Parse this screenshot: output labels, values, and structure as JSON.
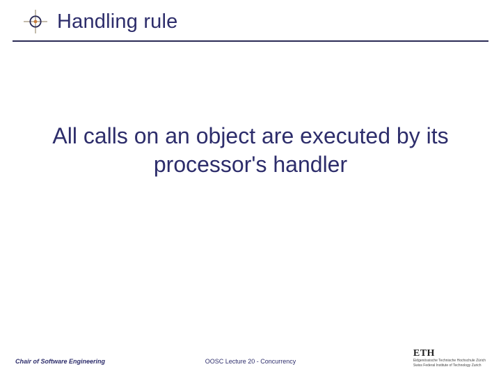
{
  "header": {
    "title": "Handling rule",
    "icon": "cross-dot-icon"
  },
  "body": {
    "text": "All calls on an object are executed by its processor's handler"
  },
  "footer": {
    "left": "Chair of Software Engineering",
    "center": "OOSC  Lecture 20 - Concurrency",
    "logo": "ETH",
    "logo_sub1": "Eidgenössische Technische Hochschule Zürich",
    "logo_sub2": "Swiss Federal Institute of Technology Zurich"
  }
}
